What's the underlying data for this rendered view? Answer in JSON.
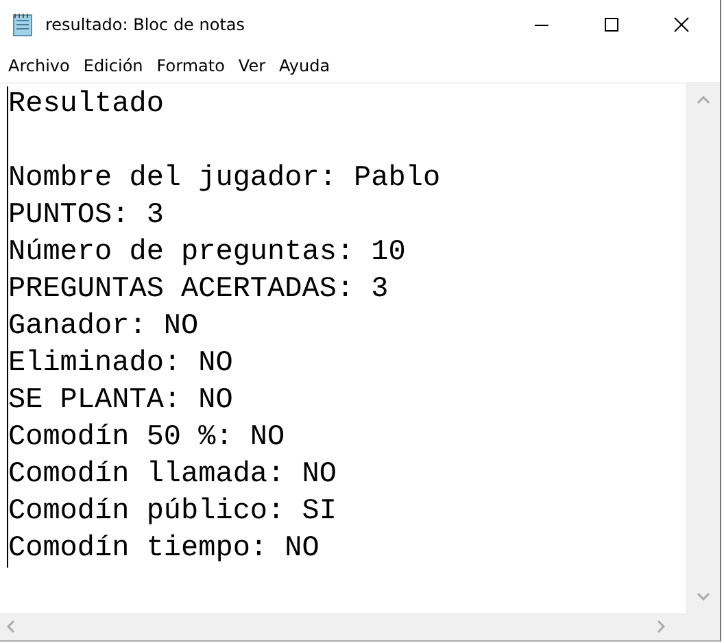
{
  "window": {
    "title": "resultado: Bloc de notas"
  },
  "menu": [
    "Archivo",
    "Edición",
    "Formato",
    "Ver",
    "Ayuda"
  ],
  "document": {
    "heading": "Resultado",
    "lines": [
      "Nombre del jugador: Pablo",
      "PUNTOS: 3",
      "Número de preguntas: 10",
      "PREGUNTAS ACERTADAS: 3",
      "Ganador: NO",
      "Eliminado: NO",
      "SE PLANTA: NO",
      "Comodín 50 %: NO",
      "Comodín llamada: NO",
      "Comodín público: SI",
      "Comodín tiempo: NO"
    ]
  }
}
